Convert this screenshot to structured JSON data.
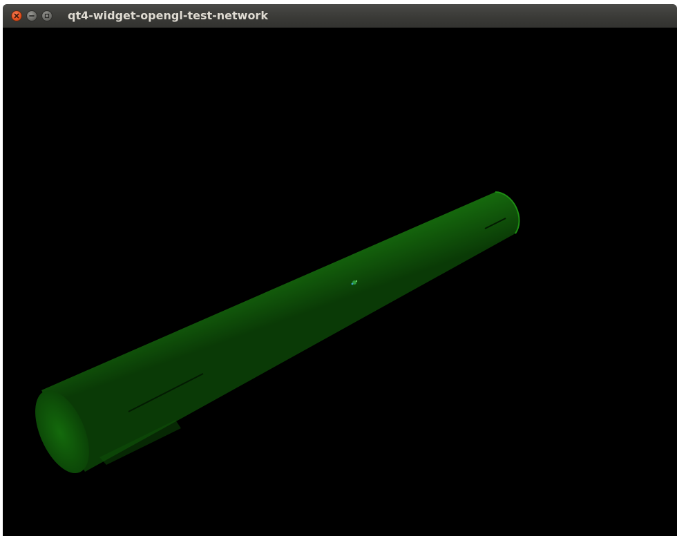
{
  "window": {
    "title": "qt4-widget-opengl-test-network",
    "controls": {
      "close_icon": "close-icon",
      "minimize_icon": "minimize-icon",
      "maximize_icon": "maximize-icon"
    }
  },
  "scene": {
    "background_color": "#000000",
    "object": "green-cylinder",
    "cylinder_color": "#1a7a0f",
    "cylinder_shadow_color": "#0c3d07",
    "marker_color": "#2c9a3a"
  }
}
